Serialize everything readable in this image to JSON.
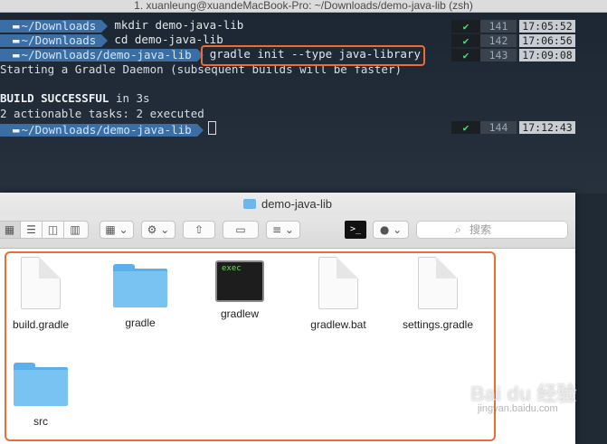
{
  "terminal": {
    "title": "1. xuanleung@xuandeMacBook-Pro: ~/Downloads/demo-java-lib (zsh)",
    "lines": [
      {
        "prompt": "~/Downloads",
        "command": "mkdir demo-java-lib",
        "status_ok": "✔",
        "num": "141",
        "time": "17:05:52"
      },
      {
        "prompt": "~/Downloads",
        "command": "cd demo-java-lib",
        "status_ok": "✔",
        "num": "142",
        "time": "17:06:56"
      },
      {
        "prompt": "~/Downloads/demo-java-lib",
        "command": "gradle init --type java-library",
        "status_ok": "✔",
        "num": "143",
        "time": "17:09:08"
      }
    ],
    "output_daemon": "Starting a Gradle Daemon (subsequent builds will be faster)",
    "build_status": "BUILD SUCCESSFUL",
    "build_time": " in 3s",
    "tasks_line": "2 actionable tasks: 2 executed",
    "last_prompt": {
      "prompt": "~/Downloads/demo-java-lib",
      "status_ok": "✔",
      "num": "144",
      "time": "17:12:43"
    }
  },
  "finder": {
    "title": "demo-java-lib",
    "search_placeholder": "搜索",
    "files": [
      {
        "name": "build.gradle"
      },
      {
        "name": "gradle"
      },
      {
        "name": "gradlew",
        "thumb": "exec"
      },
      {
        "name": "gradlew.bat"
      },
      {
        "name": "settings.gradle"
      },
      {
        "name": "src"
      }
    ]
  },
  "watermark": {
    "text": "Bai du 经验",
    "sub": "jingyan.baidu.com"
  }
}
